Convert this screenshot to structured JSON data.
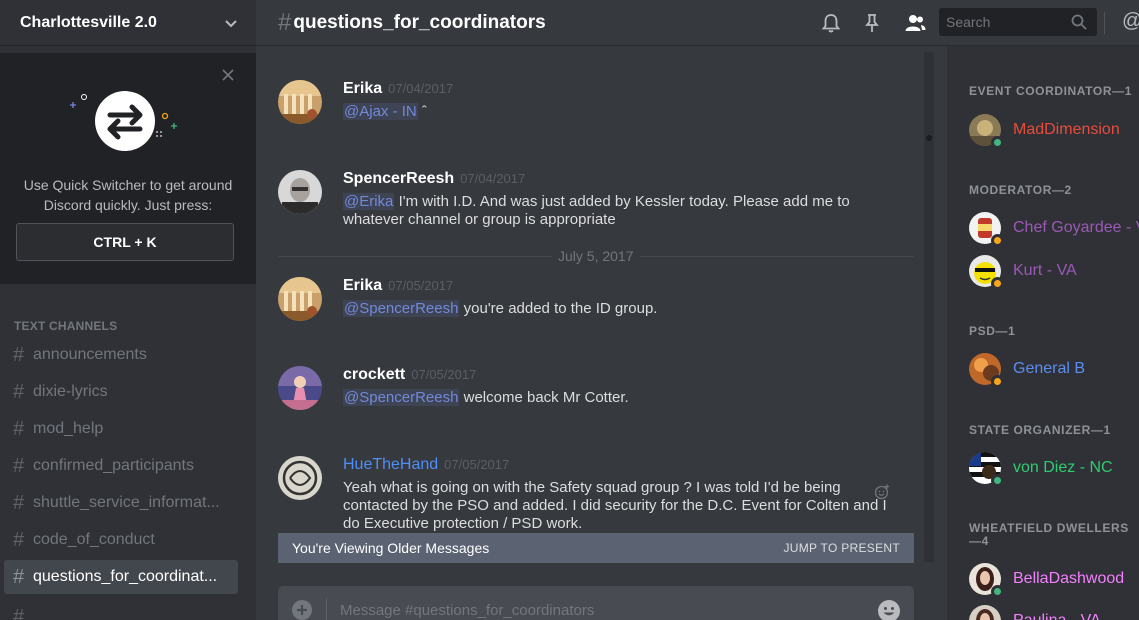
{
  "server": {
    "name": "Charlottesville 2.0"
  },
  "quick_switcher": {
    "text_line1": "Use Quick Switcher to get around",
    "text_line2": "Discord quickly. Just press:",
    "shortcut": "CTRL + K"
  },
  "channels": {
    "category": "TEXT CHANNELS",
    "items": [
      {
        "name": "announcements",
        "active": false
      },
      {
        "name": "dixie-lyrics",
        "active": false
      },
      {
        "name": "mod_help",
        "active": false
      },
      {
        "name": "confirmed_participants",
        "active": false
      },
      {
        "name": "shuttle_service_informat...",
        "active": false
      },
      {
        "name": "code_of_conduct",
        "active": false
      },
      {
        "name": "questions_for_coordinat...",
        "active": true
      }
    ]
  },
  "header": {
    "channel": "questions_for_coordinators",
    "search_placeholder": "Search"
  },
  "messages": [
    {
      "author": "Erika",
      "time": "07/04/2017",
      "mention": "@Ajax - IN",
      "text": " ˆ",
      "avatar": "erika"
    },
    {
      "author": "SpencerReesh",
      "time": "07/04/2017",
      "mention": "@Erika",
      "text": " I'm with I.D. And was just added by Kessler today. Please add me to whatever channel or group is appropriate",
      "avatar": "spencer"
    },
    {
      "author": "Erika",
      "time": "07/05/2017",
      "mention": "@SpencerReesh",
      "text": " you're added to the ID group.",
      "avatar": "erika"
    },
    {
      "author": "crockett",
      "time": "07/05/2017",
      "mention": "@SpencerReesh",
      "text": " welcome back Mr Cotter.",
      "avatar": "crockett"
    },
    {
      "author": "HueTheHand",
      "time": "07/05/2017",
      "mention": "",
      "text": "Yeah what is going on with the Safety squad group ? I was told I'd be being contacted by the PSO and added. I did security for the D.C. Event for Colten and I do Executive protection / PSD work.",
      "avatar": "hue"
    }
  ],
  "date_divider": "July 5, 2017",
  "older_bar": {
    "label": "You're Viewing Older Messages",
    "action": "JUMP TO PRESENT"
  },
  "composer": {
    "placeholder": "Message #questions_for_coordinators"
  },
  "members": {
    "groups": [
      {
        "title": "EVENT COORDINATOR—1",
        "members": [
          {
            "name": "MadDimension",
            "color": "#e74c3c",
            "status": "online"
          }
        ]
      },
      {
        "title": "MODERATOR—2",
        "members": [
          {
            "name": "Chef Goyardee - VA",
            "color": "#9b59b6",
            "status": "idle"
          },
          {
            "name": "Kurt - VA",
            "color": "#9b59b6",
            "status": "idle"
          }
        ]
      },
      {
        "title": "PSD—1",
        "members": [
          {
            "name": "General B",
            "color": "#5b8def",
            "status": "idle"
          }
        ]
      },
      {
        "title": "STATE ORGANIZER—1",
        "members": [
          {
            "name": "von Diez - NC",
            "color": "#2ecc71",
            "status": "online"
          }
        ]
      },
      {
        "title": "WHEATFIELD DWELLERS—4",
        "members": [
          {
            "name": "BellaDashwood",
            "color": "#f47fff",
            "status": "online"
          },
          {
            "name": "Paulina - VA",
            "color": "#f47fff",
            "status": "online"
          }
        ]
      }
    ]
  },
  "colors": {
    "online": "#43b581",
    "idle": "#faa61a",
    "accent": "#7289da"
  }
}
